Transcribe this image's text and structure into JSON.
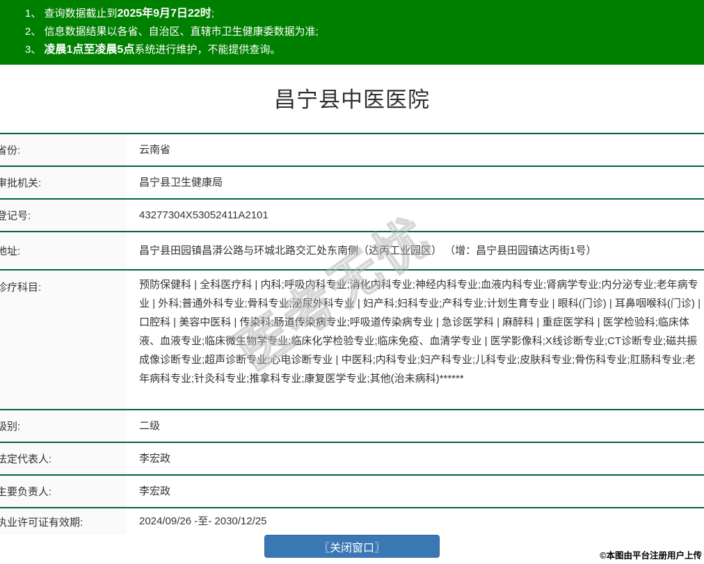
{
  "colors": {
    "header_bg": "#008000",
    "divider_green": "#00633A",
    "label_column_bg": "#FAFAFA",
    "button_bg": "#3A77B5",
    "body_text": "#333333"
  },
  "header": {
    "notices": [
      {
        "pre": "1、 查询数据截止到",
        "bold": "2025年9月7日22时",
        "post": ";"
      },
      {
        "pre": "2、 信息数据结果以各省、自治区、直辖市卫生健康委数据为准;",
        "bold": "",
        "post": ""
      },
      {
        "pre": "3、 ",
        "bold": "凌晨1点至凌晨5点",
        "post": "系统进行维护，不能提供查询。"
      }
    ]
  },
  "title": "昌宁县中医医院",
  "table": {
    "rows": [
      {
        "label": "省份:",
        "value": "云南省"
      },
      {
        "label": "审批机关:",
        "value": "昌宁县卫生健康局"
      },
      {
        "label": "登记号:",
        "value": "43277304X53052411A2101"
      },
      {
        "label": "地址:",
        "value": "昌宁县田园镇昌漭公路与环城北路交汇处东南侧（达丙工业园区） （增：昌宁县田园镇达丙街1号）"
      },
      {
        "label": "诊疗科目:",
        "value": "预防保健科 | 全科医疗科 | 内科;呼吸内科专业;消化内科专业;神经内科专业;血液内科专业;肾病学专业;内分泌专业;老年病专业 | 外科;普通外科专业;骨科专业;泌尿外科专业 | 妇产科;妇科专业;产科专业;计划生育专业 | 眼科(门诊) | 耳鼻咽喉科(门诊) | 口腔科 | 美容中医科 | 传染科;肠道传染病专业;呼吸道传染病专业 | 急诊医学科 | 麻醉科 | 重症医学科 | 医学检验科;临床体液、血液专业;临床微生物学专业;临床化学检验专业;临床免疫、血清学专业 | 医学影像科;X线诊断专业;CT诊断专业;磁共振成像诊断专业;超声诊断专业;心电诊断专业 | 中医科;内科专业;妇产科专业;儿科专业;皮肤科专业;骨伤科专业;肛肠科专业;老年病科专业;针灸科专业;推拿科专业;康复医学专业;其他(治未病科)******"
      },
      {
        "label": "级别:",
        "value": "二级"
      },
      {
        "label": "法定代表人:",
        "value": "李宏政"
      },
      {
        "label": "主要负责人:",
        "value": "李宏政"
      },
      {
        "label": "执业许可证有效期:",
        "value": "2024/09/26 -至- 2030/12/25"
      }
    ]
  },
  "watermark": {
    "text": "医考无忧"
  },
  "footer": {
    "close_button": "〖关闭窗口〗",
    "upload_credit": "©本图由平台注册用户上传"
  }
}
